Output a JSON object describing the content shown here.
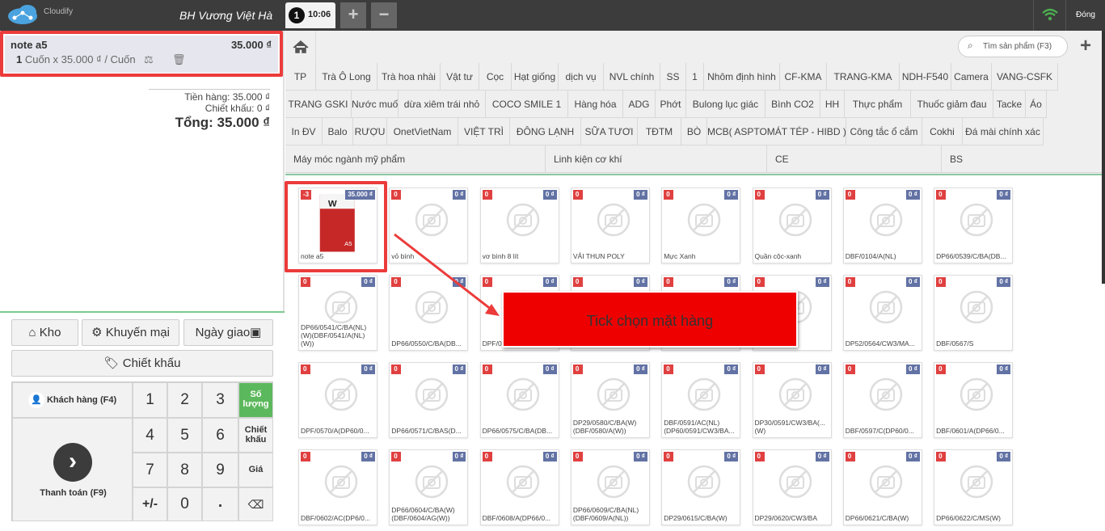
{
  "header": {
    "logo_text": "Cloudify",
    "store_name": "BH Vương Việt Hà",
    "tab_number": "1",
    "tab_time": "10:06",
    "add_tab": "+",
    "remove_tab": "−",
    "close_label": "Đóng"
  },
  "cart": {
    "item_name": "note a5",
    "item_price": "35.000 ₫",
    "item_qty": "1",
    "item_unit_text": "Cuốn x 35.000 ₫ / Cuốn"
  },
  "totals": {
    "subtotal": "Tiền hàng: 35.000 ₫",
    "discount": "Chiết khấu: 0 ₫",
    "total": "Tổng: 35.000 ₫"
  },
  "actions": {
    "warehouse": "Kho",
    "promotion": "Khuyến mại",
    "delivery_date": "Ngày giao",
    "discount": "Chiết khấu",
    "customer": "Khách hàng (F4)",
    "payment": "Thanh toán (F9)",
    "quantity": "Số lượng",
    "discount_key": "Chiết khấu",
    "price": "Giá",
    "plusminus": "+/-",
    "dot": "."
  },
  "keypad": [
    "1",
    "2",
    "3",
    "4",
    "5",
    "6",
    "7",
    "8",
    "9",
    "0"
  ],
  "search": {
    "placeholder": "Tìm sản phẩm (F3)"
  },
  "categories": {
    "row1": [
      "TP",
      "Trà Ô Long",
      "Trà hoa nhài",
      "Vật tư",
      "Cọc",
      "Hạt giống",
      "dịch vụ",
      "NVL chính",
      "SS",
      "1",
      "Nhôm định hình",
      "CF-KMA",
      "TRANG-KMA",
      "NDH-F540",
      "Camera",
      "VANG-CSFK"
    ],
    "row2": [
      "TRANG GSKI",
      "Nước muối",
      "dừa xiêm trái nhỏ",
      "COCO SMILE 1",
      "Hàng hóa",
      "ADG",
      "Phớt",
      "Bulong lục giác",
      "Bình CO2",
      "HH",
      "Thực phẩm",
      "Thuốc giảm đau",
      "Tacke",
      "Áo"
    ],
    "row3": [
      "In ĐV",
      "Balo",
      "RƯỢU",
      "OnetVietNam",
      "VIỆT TRÌ",
      "ĐÔNG LẠNH",
      "SỮA TƯƠI",
      "TĐTM",
      "BÒ",
      "MCB( ASPTOMÁT TÉP - HIBD )",
      "Công tắc ổ cắm",
      "Cokhi",
      "Đá mài chính xác"
    ],
    "row4": [
      "Máy móc ngành mỹ phẩm",
      "Linh kiện cơ khí",
      "CE",
      "BS"
    ]
  },
  "products": [
    {
      "name": "note a5",
      "stock": "-3",
      "price": "35.000 ₫"
    },
    {
      "name": "vỏ bình",
      "stock": "0",
      "price": "0 ₫"
    },
    {
      "name": "vơ bình 8 lít",
      "stock": "0",
      "price": "0 ₫"
    },
    {
      "name": "VẢI THUN POLY",
      "stock": "0",
      "price": "0 ₫"
    },
    {
      "name": "Mực Xanh",
      "stock": "0",
      "price": "0 ₫"
    },
    {
      "name": "Quần cộc-xanh",
      "stock": "0",
      "price": "0 ₫"
    },
    {
      "name": "DBF/0104/A(NL)",
      "stock": "0",
      "price": "0 ₫"
    },
    {
      "name": "DP66/0539/C/BA(DB...",
      "stock": "0",
      "price": "0 ₫"
    },
    {
      "name": "DP66/0541/C/BA(NL)(W)(DBF/0541/A(NL)(W))",
      "stock": "0",
      "price": "0 ₫"
    },
    {
      "name": "DP66/0550/C/BA(DB...",
      "stock": "0",
      "price": "0 ₫"
    },
    {
      "name": "DPF/0...",
      "stock": "0",
      "price": "0 ₫"
    },
    {
      "name": "",
      "stock": "0",
      "price": "0 ₫"
    },
    {
      "name": "",
      "stock": "0",
      "price": "0 ₫"
    },
    {
      "name": "FF160/0...",
      "stock": "0",
      "price": "0 ₫"
    },
    {
      "name": "DP52/0564/CW3/MA...",
      "stock": "0",
      "price": "0 ₫"
    },
    {
      "name": "DBF/0567/S",
      "stock": "0",
      "price": "0 ₫"
    },
    {
      "name": "DPF/0570/A(DP60/0...",
      "stock": "0",
      "price": "0 ₫"
    },
    {
      "name": "DP66/0571/C/BAS(D...",
      "stock": "0",
      "price": "0 ₫"
    },
    {
      "name": "DP66/0575/C/BA(DB...",
      "stock": "0",
      "price": "0 ₫"
    },
    {
      "name": "DP29/0580/C/BA(W)(DBF/0580/A(W))",
      "stock": "0",
      "price": "0 ₫"
    },
    {
      "name": "DBF/0591/AC(NL)(DP60/0591/CW3/BA...",
      "stock": "0",
      "price": "0 ₫"
    },
    {
      "name": "DP30/0591/CW3/BA(...(W)",
      "stock": "0",
      "price": "0 ₫"
    },
    {
      "name": "DBF/0597/C(DP60/0...",
      "stock": "0",
      "price": "0 ₫"
    },
    {
      "name": "DBF/0601/A(DP66/0...",
      "stock": "0",
      "price": "0 ₫"
    },
    {
      "name": "DBF/0602/AC(DP6/0...",
      "stock": "0",
      "price": "0 ₫"
    },
    {
      "name": "DP66/0604/C/BA(W)(DBF/0604/AG(W))",
      "stock": "0",
      "price": "0 ₫"
    },
    {
      "name": "DBF/0608/A(DP66/0...",
      "stock": "0",
      "price": "0 ₫"
    },
    {
      "name": "DP66/0609/C/BA(NL)(DBF/0609/A(NL))",
      "stock": "0",
      "price": "0 ₫"
    },
    {
      "name": "DP29/0615/C/BA(W)",
      "stock": "0",
      "price": "0 ₫"
    },
    {
      "name": "DP29/0620/CW3/BA",
      "stock": "0",
      "price": "0 ₫"
    },
    {
      "name": "DP66/0621/C/BA(W)",
      "stock": "0",
      "price": "0 ₫"
    },
    {
      "name": "DP66/0622/C/MS(W)",
      "stock": "0",
      "price": "0 ₫"
    }
  ],
  "callout": "Tick chọn mặt hàng",
  "colors": {
    "accent_red": "#ec3b3b",
    "stock_badge": "#e04040",
    "price_badge": "#6272a4",
    "green": "#4caf50"
  }
}
